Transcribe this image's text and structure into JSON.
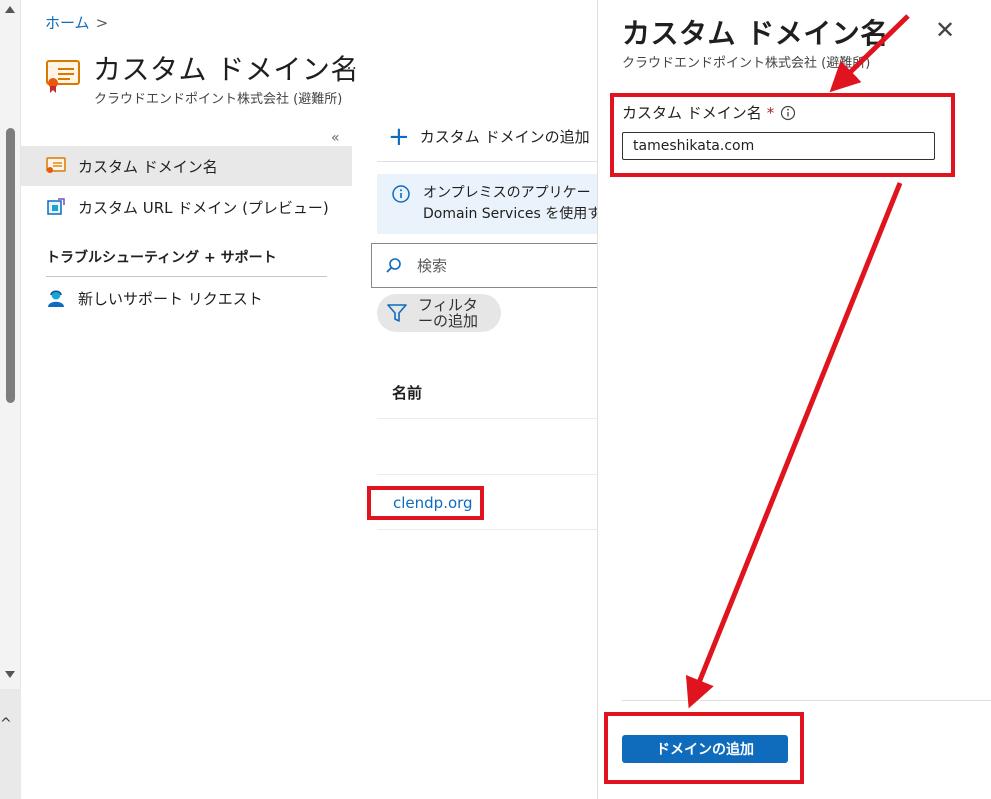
{
  "breadcrumb": {
    "home": "ホーム",
    "separator": ">"
  },
  "page": {
    "title": "カスタム ドメイン名",
    "subtitle": "クラウドエンドポイント株式会社 (避難所)",
    "more": "…",
    "collapse": "«"
  },
  "sidebar": {
    "items": [
      {
        "label": "カスタム ドメイン名",
        "icon": "certificate-icon"
      },
      {
        "label": "カスタム URL ドメイン (プレビュー)",
        "icon": "custom-url-icon"
      }
    ],
    "section": "トラブルシューティング + サポート",
    "support_item": {
      "label": "新しいサポート リクエスト",
      "icon": "person-support-icon"
    }
  },
  "main": {
    "add_command": "カスタム ドメインの追加",
    "info_line1": "オンプレミスのアプリケー",
    "info_line2": "Domain Services を使用す",
    "search_placeholder": "検索",
    "filter_line1": "フィルタ",
    "filter_line2": "ーの追加",
    "column_name": "名前",
    "domains": [
      "clendp.org"
    ]
  },
  "panel": {
    "title": "カスタム ドメイン名",
    "subtitle": "クラウドエンドポイント株式会社 (避難所)",
    "field_label": "カスタム ドメイン名",
    "required_mark": "*",
    "field_value": "tameshikata.com",
    "submit": "ドメインの追加"
  },
  "colors": {
    "accent": "#0f6cbd",
    "annotation": "#e0141e",
    "info_bg": "#eaf2fb"
  }
}
